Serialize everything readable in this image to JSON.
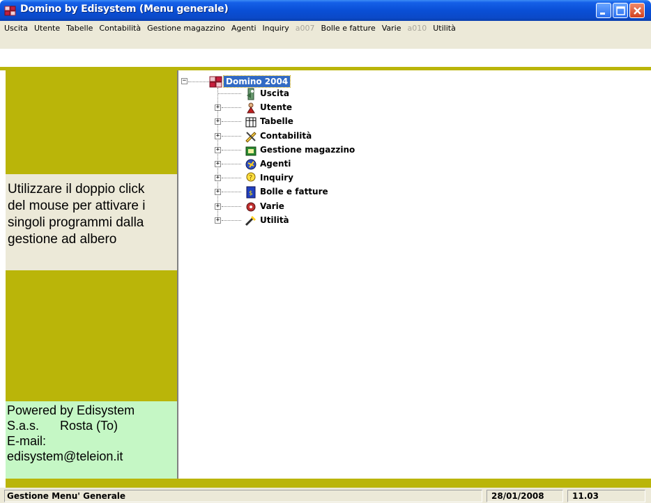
{
  "window": {
    "title": "Domino by Edisystem (Menu generale)",
    "colors": {
      "titlebar": "#0a4fd6",
      "olive": "#bab509",
      "info_bg": "#ece9d8",
      "powered_bg": "#c5f7c5",
      "selection": "#316ac5"
    }
  },
  "menu": {
    "items": [
      {
        "label": "Uscita",
        "enabled": true
      },
      {
        "label": "Utente",
        "enabled": true
      },
      {
        "label": "Tabelle",
        "enabled": true
      },
      {
        "label": "Contabilità",
        "enabled": true
      },
      {
        "label": "Gestione magazzino",
        "enabled": true
      },
      {
        "label": "Agenti",
        "enabled": true
      },
      {
        "label": "Inquiry",
        "enabled": true
      },
      {
        "label": "a007",
        "enabled": false
      },
      {
        "label": "Bolle e fatture",
        "enabled": true
      },
      {
        "label": "Varie",
        "enabled": true
      },
      {
        "label": "a010",
        "enabled": false
      },
      {
        "label": "Utilità",
        "enabled": true
      }
    ]
  },
  "left_panel": {
    "info_lines": [
      "Utilizzare il doppio click",
      "del mouse per attivare i",
      "singoli programmi dalla",
      "gestione ad albero"
    ],
    "powered_lines": [
      "Powered by Edisystem",
      "S.a.s.      Rosta (To)",
      "E-mail:",
      "edisystem@teleion.it"
    ]
  },
  "tree": {
    "root": {
      "label": "Domino 2004",
      "expanded": true,
      "icon": "domino-icon"
    },
    "children": [
      {
        "label": "Uscita",
        "has_children": false,
        "icon": "exit-icon"
      },
      {
        "label": "Utente",
        "has_children": true,
        "icon": "user-icon"
      },
      {
        "label": "Tabelle",
        "has_children": true,
        "icon": "tables-icon"
      },
      {
        "label": "Contabilità",
        "has_children": true,
        "icon": "accounting-icon"
      },
      {
        "label": "Gestione magazzino",
        "has_children": true,
        "icon": "warehouse-icon"
      },
      {
        "label": "Agenti",
        "has_children": true,
        "icon": "agents-icon"
      },
      {
        "label": "Inquiry",
        "has_children": true,
        "icon": "inquiry-icon"
      },
      {
        "label": "Bolle e fatture",
        "has_children": true,
        "icon": "invoice-icon"
      },
      {
        "label": "Varie",
        "has_children": true,
        "icon": "misc-icon"
      },
      {
        "label": "Utilità",
        "has_children": true,
        "icon": "utility-icon"
      }
    ]
  },
  "status": {
    "message": "Gestione Menu' Generale",
    "date": "28/01/2008",
    "time": "11.03"
  }
}
